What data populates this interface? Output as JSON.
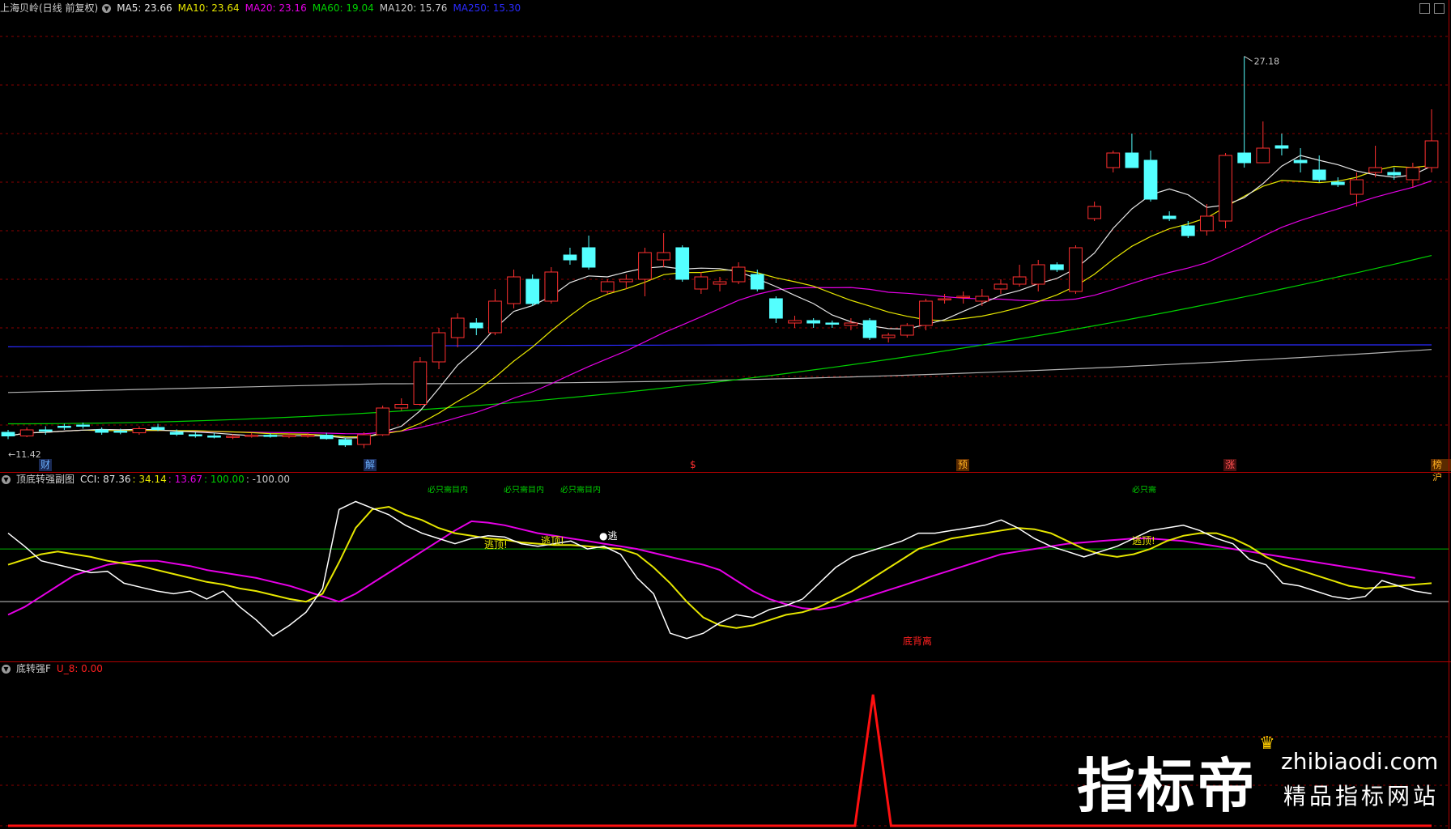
{
  "main_header": {
    "title": "上海贝岭(日线 前复权)",
    "ma": [
      {
        "label": "MA5: 23.66",
        "color": "#e6e6e6"
      },
      {
        "label": "MA10: 23.64",
        "color": "#e6e600"
      },
      {
        "label": "MA20: 23.16",
        "color": "#e600e6"
      },
      {
        "label": "MA60: 19.04",
        "color": "#00d000"
      },
      {
        "label": "MA120: 15.76",
        "color": "#c8c8c8"
      },
      {
        "label": "MA250: 15.30",
        "color": "#2a2aff"
      }
    ]
  },
  "price_labels": {
    "high": "27.18",
    "low": "11.42"
  },
  "event_markers": [
    {
      "label": "财",
      "color": "#6ab0ff"
    },
    {
      "label": "解",
      "color": "#6ab0ff"
    },
    {
      "label": "$",
      "color": "#ff3030"
    },
    {
      "label": "预",
      "color": "#ffb020"
    },
    {
      "label": "涨",
      "color": "#ff5050"
    },
    {
      "label": "榜沪",
      "color": "#ffb020"
    }
  ],
  "cci_header": {
    "name": "顶底转强副图",
    "values": [
      {
        "label": "CCI: 87.36",
        "color": "#e6e6e6"
      },
      {
        "label": ": 34.14",
        "color": "#e6e600"
      },
      {
        "label": ": 13.67",
        "color": "#e600e6"
      },
      {
        "label": ": 100.00",
        "color": "#00d000"
      },
      {
        "label": ": -100.00",
        "color": "#c8c8c8"
      }
    ]
  },
  "cci_annotations": [
    {
      "text": "必只需目内",
      "color": "#00d000"
    },
    {
      "text": "必只需目内",
      "color": "#00d000"
    },
    {
      "text": "必只需目内",
      "color": "#00d000"
    },
    {
      "text": "必只需",
      "color": "#00d000"
    },
    {
      "text": "逃顶!",
      "color": "#e6e600"
    },
    {
      "text": "逃顶!",
      "color": "#e6e600"
    },
    {
      "text": "●逃",
      "color": "#ffffff"
    },
    {
      "text": "逃顶!",
      "color": "#e6e600"
    },
    {
      "text": "底背离",
      "color": "#ff2020"
    }
  ],
  "sig_header": {
    "name": "底转强F",
    "value": "U_8: 0.00",
    "value_color": "#ff2020"
  },
  "watermark": {
    "brand": "指标帝",
    "url": "zhibiaodi.com",
    "slogan": "精品指标网站"
  },
  "colors": {
    "up": "#ff3030",
    "down": "#54ffff",
    "grid": "#8a0000"
  },
  "chart_data": [
    {
      "type": "candlestick",
      "title": "上海贝岭(日线 前复权)",
      "y_range": [
        11.0,
        28.5
      ],
      "candles": [
        [
          11.7,
          11.55,
          11.8,
          11.42
        ],
        [
          11.55,
          11.8,
          11.9,
          11.5
        ],
        [
          11.8,
          11.75,
          11.95,
          11.6
        ],
        [
          11.95,
          11.9,
          12.05,
          11.8
        ],
        [
          12.0,
          11.95,
          12.1,
          11.85
        ],
        [
          11.8,
          11.7,
          11.9,
          11.6
        ],
        [
          11.75,
          11.72,
          11.85,
          11.62
        ],
        [
          11.68,
          11.85,
          11.95,
          11.6
        ],
        [
          11.9,
          11.82,
          12.05,
          11.75
        ],
        [
          11.7,
          11.62,
          11.82,
          11.55
        ],
        [
          11.6,
          11.56,
          11.7,
          11.48
        ],
        [
          11.55,
          11.52,
          11.68,
          11.45
        ],
        [
          11.5,
          11.54,
          11.62,
          11.42
        ],
        [
          11.55,
          11.58,
          11.68,
          11.48
        ],
        [
          11.58,
          11.56,
          11.66,
          11.48
        ],
        [
          11.52,
          11.58,
          11.66,
          11.46
        ],
        [
          11.55,
          11.58,
          11.66,
          11.48
        ],
        [
          11.58,
          11.44,
          11.68,
          11.4
        ],
        [
          11.4,
          11.18,
          11.48,
          11.1
        ],
        [
          11.2,
          11.6,
          11.7,
          11.05
        ],
        [
          11.6,
          12.7,
          12.8,
          11.55
        ],
        [
          12.7,
          12.85,
          13.1,
          12.6
        ],
        [
          12.85,
          14.6,
          14.8,
          12.8
        ],
        [
          14.6,
          15.8,
          16.0,
          14.3
        ],
        [
          15.6,
          16.4,
          16.6,
          15.2
        ],
        [
          16.2,
          16.0,
          16.4,
          15.7
        ],
        [
          15.8,
          17.1,
          17.6,
          15.7
        ],
        [
          17.0,
          18.1,
          18.4,
          16.8
        ],
        [
          18.0,
          17.0,
          18.2,
          16.9
        ],
        [
          17.1,
          18.3,
          18.5,
          17.0
        ],
        [
          19.0,
          18.8,
          19.3,
          18.6
        ],
        [
          19.3,
          18.5,
          19.8,
          18.4
        ],
        [
          17.5,
          17.9,
          18.0,
          17.4
        ],
        [
          17.9,
          18.0,
          18.2,
          17.6
        ],
        [
          18.0,
          19.1,
          19.3,
          17.3
        ],
        [
          18.8,
          19.1,
          19.9,
          18.5
        ],
        [
          19.3,
          18.0,
          19.4,
          17.9
        ],
        [
          17.6,
          18.1,
          18.3,
          17.4
        ],
        [
          17.8,
          17.9,
          18.1,
          17.5
        ],
        [
          17.9,
          18.5,
          18.7,
          17.8
        ],
        [
          18.2,
          17.6,
          18.4,
          17.5
        ],
        [
          17.2,
          16.4,
          17.3,
          16.2
        ],
        [
          16.2,
          16.3,
          16.5,
          16.0
        ],
        [
          16.3,
          16.2,
          16.4,
          16.0
        ],
        [
          16.2,
          16.15,
          16.3,
          16.0
        ],
        [
          16.1,
          16.2,
          16.4,
          15.9
        ],
        [
          16.3,
          15.6,
          16.4,
          15.5
        ],
        [
          15.6,
          15.7,
          15.8,
          15.4
        ],
        [
          15.7,
          16.1,
          16.2,
          15.6
        ],
        [
          16.1,
          17.1,
          17.2,
          15.9
        ],
        [
          17.2,
          17.2,
          17.4,
          17.0
        ],
        [
          17.3,
          17.3,
          17.5,
          17.0
        ],
        [
          17.1,
          17.3,
          17.6,
          16.9
        ],
        [
          17.6,
          17.8,
          18.0,
          17.4
        ],
        [
          17.8,
          18.1,
          18.6,
          17.7
        ],
        [
          17.8,
          18.6,
          18.8,
          17.5
        ],
        [
          18.6,
          18.4,
          18.7,
          18.3
        ],
        [
          17.5,
          19.3,
          19.4,
          17.4
        ],
        [
          20.5,
          21.0,
          21.2,
          20.4
        ],
        [
          22.6,
          23.2,
          23.3,
          22.4
        ],
        [
          23.2,
          22.6,
          24.0,
          22.6
        ],
        [
          22.9,
          21.3,
          23.3,
          21.2
        ],
        [
          20.6,
          20.5,
          20.8,
          20.4
        ],
        [
          20.2,
          19.8,
          20.4,
          19.7
        ],
        [
          20.0,
          20.6,
          21.1,
          19.8
        ],
        [
          20.4,
          23.1,
          23.2,
          20.1
        ],
        [
          23.2,
          22.8,
          27.18,
          22.6
        ],
        [
          22.8,
          23.4,
          24.5,
          22.8
        ],
        [
          23.5,
          23.4,
          24.0,
          23.1
        ],
        [
          22.9,
          22.8,
          23.4,
          22.4
        ],
        [
          22.5,
          22.1,
          23.1,
          22.0
        ],
        [
          22.0,
          21.9,
          22.2,
          21.8
        ],
        [
          21.5,
          22.1,
          22.4,
          21.0
        ],
        [
          22.4,
          22.6,
          23.5,
          22.2
        ],
        [
          22.4,
          22.3,
          22.6,
          22.1
        ],
        [
          22.1,
          22.6,
          22.8,
          21.8
        ],
        [
          22.6,
          23.7,
          25.0,
          22.4
        ]
      ]
    },
    {
      "type": "line",
      "title": "顶底转强副图",
      "y_range": [
        -330,
        340
      ],
      "series": [
        {
          "name": "CCI",
          "values": [
            160,
            110,
            55,
            40,
            25,
            10,
            15,
            -30,
            -45,
            -60,
            -70,
            -60,
            -90,
            -60,
            -120,
            -170,
            -230,
            -190,
            -140,
            -50,
            250,
            280,
            255,
            230,
            190,
            160,
            140,
            120,
            140,
            150,
            145,
            120,
            110,
            120,
            130,
            100,
            110,
            80,
            -10,
            -70,
            -220,
            -240,
            -220,
            -180,
            -150,
            -160,
            -130,
            -115,
            -90,
            -30,
            30,
            70,
            90,
            110,
            130,
            160,
            160,
            170,
            180,
            190,
            210,
            180,
            140,
            110,
            90,
            70,
            90,
            110,
            140,
            170,
            180,
            190,
            170,
            140,
            120,
            60,
            40,
            -30,
            -40,
            -60,
            -80,
            -90,
            -80,
            -20,
            -40,
            -60,
            -70
          ]
        },
        {
          "name": "MA2",
          "values": [
            40,
            60,
            80,
            90,
            80,
            70,
            55,
            45,
            35,
            20,
            5,
            -10,
            -25,
            -35,
            -50,
            -60,
            -75,
            -90,
            -100,
            -70,
            50,
            180,
            250,
            260,
            230,
            210,
            180,
            160,
            150,
            140,
            135,
            125,
            120,
            115,
            115,
            110,
            105,
            100,
            80,
            30,
            -30,
            -100,
            -160,
            -190,
            -200,
            -190,
            -170,
            -150,
            -140,
            -120,
            -90,
            -60,
            -20,
            20,
            60,
            100,
            120,
            140,
            150,
            160,
            170,
            180,
            175,
            160,
            130,
            100,
            80,
            70,
            80,
            100,
            130,
            150,
            160,
            160,
            140,
            110,
            70,
            40,
            20,
            0,
            -20,
            -40,
            -50,
            -45,
            -40,
            -35,
            -30
          ]
        },
        {
          "name": "MA3",
          "values": [
            -150,
            -120,
            -80,
            -40,
            0,
            20,
            40,
            50,
            55,
            55,
            45,
            35,
            20,
            10,
            0,
            -10,
            -25,
            -40,
            -60,
            -80,
            -100,
            -70,
            -30,
            10,
            50,
            90,
            130,
            170,
            205,
            200,
            190,
            175,
            160,
            150,
            140,
            130,
            120,
            110,
            100,
            85,
            70,
            55,
            40,
            20,
            -20,
            -60,
            -90,
            -110,
            -125,
            -130,
            -120,
            -100,
            -80,
            -60,
            -40,
            -20,
            0,
            20,
            40,
            60,
            80,
            90,
            100,
            110,
            120,
            125,
            130,
            135,
            140,
            140,
            135,
            130,
            120,
            110,
            100,
            90,
            80,
            70,
            60,
            50,
            40,
            30,
            20,
            10,
            0,
            -10
          ]
        }
      ],
      "levels": [
        100,
        -100
      ]
    },
    {
      "type": "line",
      "title": "底转强F",
      "series": [
        {
          "name": "U_8",
          "values": [
            0,
            0,
            0,
            0,
            0,
            0,
            0,
            0,
            0,
            0,
            0,
            0,
            0,
            0,
            0,
            0,
            0,
            0,
            0,
            0,
            0,
            0,
            0,
            0,
            0,
            0,
            0,
            0,
            0,
            0,
            0,
            0,
            0,
            0,
            0,
            0,
            0,
            0,
            0,
            0,
            0,
            0,
            0,
            0,
            0,
            0,
            0,
            0,
            1,
            0,
            0,
            0,
            0,
            0,
            0,
            0,
            0,
            0,
            0,
            0,
            0,
            0,
            0,
            0,
            0,
            0,
            0,
            0,
            0,
            0,
            0,
            0,
            0,
            0,
            0,
            0,
            0,
            0,
            0,
            0
          ]
        }
      ],
      "y_range": [
        0,
        1
      ]
    }
  ]
}
